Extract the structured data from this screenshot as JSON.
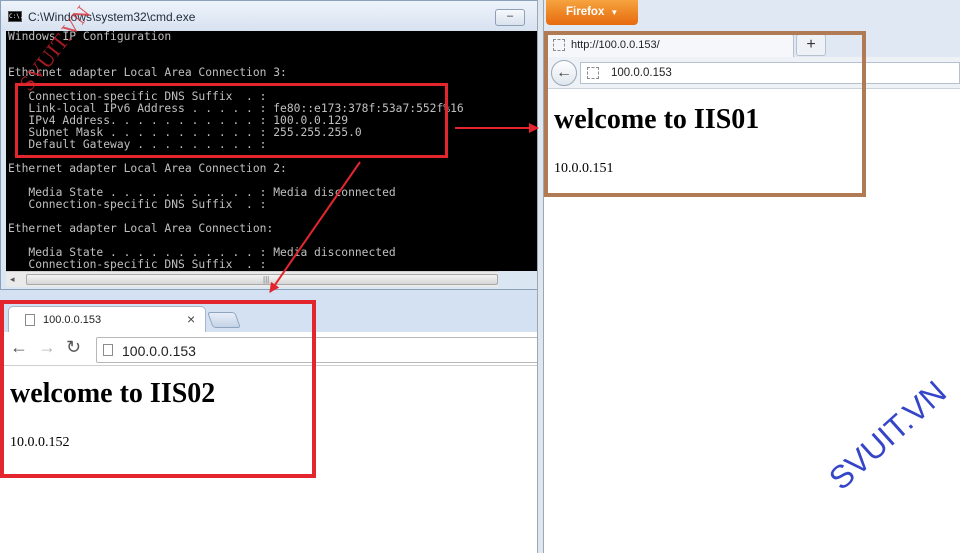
{
  "cmd": {
    "title": "C:\\Windows\\system32\\cmd.exe",
    "icon_text": "C:\\.",
    "minimize_label": "–",
    "lines": [
      "Windows IP Configuration",
      "",
      "",
      "Ethernet adapter Local Area Connection 3:",
      "",
      "   Connection-specific DNS Suffix  . :",
      "   Link-local IPv6 Address . . . . . : fe80::e173:378f:53a7:552f%16",
      "   IPv4 Address. . . . . . . . . . . : 100.0.0.129",
      "   Subnet Mask . . . . . . . . . . . : 255.255.255.0",
      "   Default Gateway . . . . . . . . . :",
      "",
      "Ethernet adapter Local Area Connection 2:",
      "",
      "   Media State . . . . . . . . . . . : Media disconnected",
      "   Connection-specific DNS Suffix  . :",
      "",
      "Ethernet adapter Local Area Connection:",
      "",
      "   Media State . . . . . . . . . . . : Media disconnected",
      "   Connection-specific DNS Suffix  . :"
    ],
    "scroll_left_glyph": "◂",
    "scroll_grip_glyph": "|||"
  },
  "chrome": {
    "tab_title": "100.0.0.153",
    "tab_close": "×",
    "back_glyph": "←",
    "forward_glyph": "→",
    "reload_glyph": "↻",
    "address": "100.0.0.153",
    "heading": "welcome to IIS02",
    "body_text": "10.0.0.152"
  },
  "firefox": {
    "menu_label": "Firefox",
    "menu_arrow": "▼",
    "tab_title": "http://100.0.0.153/",
    "new_tab_label": "+",
    "back_glyph": "←",
    "address": "100.0.0.153",
    "heading": "welcome to IIS01",
    "body_text": "10.0.0.151"
  },
  "watermarks": {
    "main": "SVUIT.VN",
    "cmd": "SVUIT.VN"
  },
  "colors": {
    "annotation_red": "#e3262e",
    "annotation_brown": "#b07a55",
    "watermark_blue": "#3545c8",
    "firefox_orange": "#e66a0e"
  }
}
